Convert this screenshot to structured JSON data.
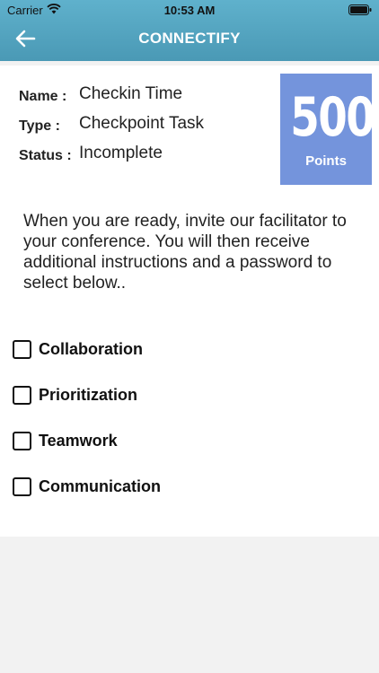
{
  "status_bar": {
    "carrier": "Carrier",
    "time": "10:53 AM"
  },
  "nav": {
    "title": "CONNECTIFY",
    "back_icon": "arrow-left-icon"
  },
  "task": {
    "name_label": "Name :",
    "name_value": "Checkin Time",
    "type_label": "Type :",
    "type_value": "Checkpoint Task",
    "status_label": "Status :",
    "status_value": "Incomplete"
  },
  "points": {
    "value": "500",
    "label": "Points",
    "color": "#7494dc"
  },
  "instructions": "When you are ready, invite our facilitator to your conference. You will then receive additional instructions and a password to select below..",
  "options": [
    {
      "label": "Collaboration",
      "checked": false
    },
    {
      "label": "Prioritization",
      "checked": false
    },
    {
      "label": "Teamwork",
      "checked": false
    },
    {
      "label": "Communication",
      "checked": false
    }
  ],
  "colors": {
    "header": "#56a8c4",
    "background": "#f2f2f2"
  }
}
